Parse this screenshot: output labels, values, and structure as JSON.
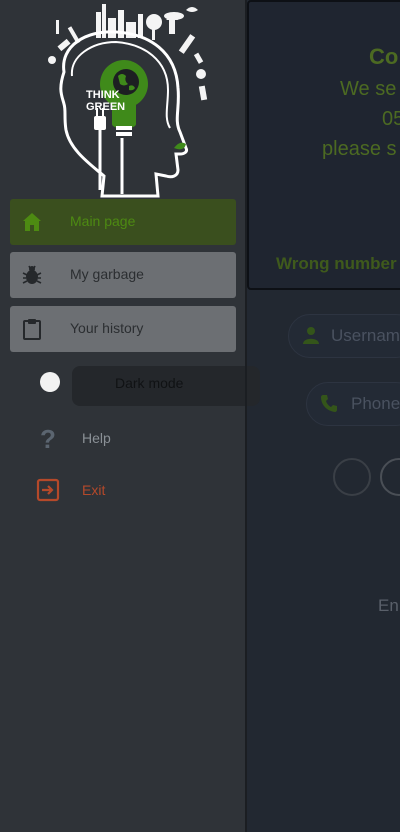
{
  "background": {
    "card_title": "Co",
    "card_lines": [
      "We se",
      "05",
      "please s"
    ],
    "wrong_number": "Wrong number",
    "username_placeholder": "Usernam",
    "phone_placeholder": "Phone",
    "enter_text": "En"
  },
  "drawer": {
    "logo": {
      "line1": "THINK",
      "line2": "GREEN"
    },
    "items": [
      {
        "label": "Main page",
        "icon": "home-icon"
      },
      {
        "label": "My garbage",
        "icon": "bug-icon"
      },
      {
        "label": "Your history",
        "icon": "clipboard-icon"
      }
    ],
    "dark_mode": {
      "label": "Dark mode",
      "enabled": false
    },
    "help": {
      "label": "Help",
      "icon": "question-icon"
    },
    "exit": {
      "label": "Exit",
      "icon": "exit-icon"
    }
  },
  "colors": {
    "accent": "#4d8a12",
    "exit": "#b5492a"
  }
}
